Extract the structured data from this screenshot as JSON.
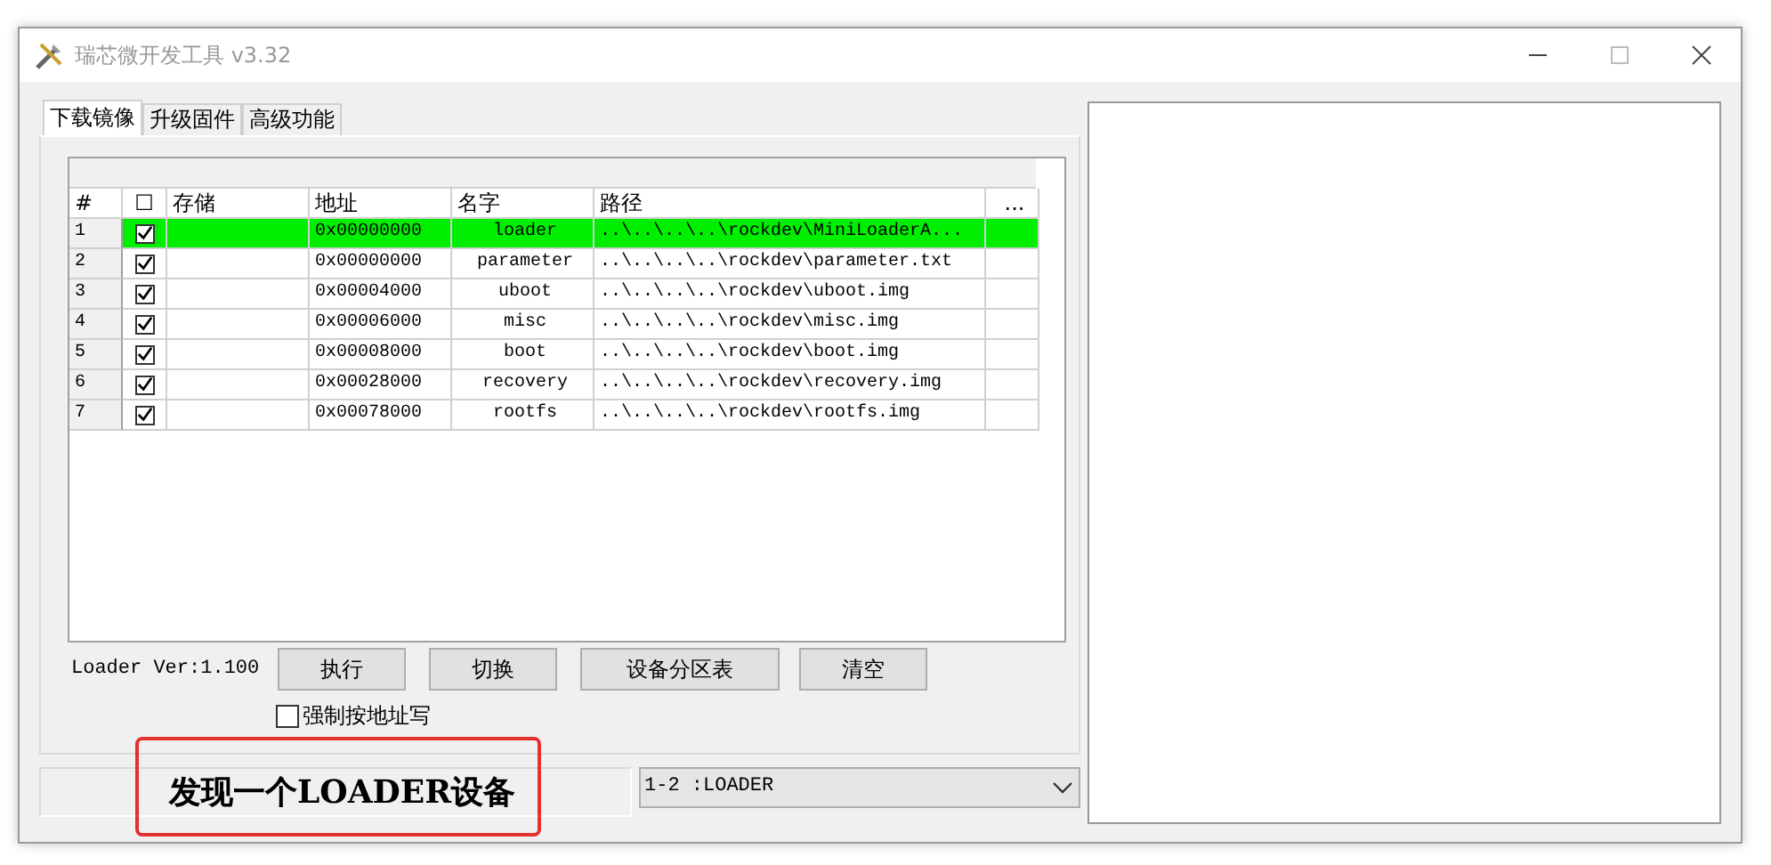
{
  "window": {
    "title": "瑞芯微开发工具 v3.32"
  },
  "tabs": [
    {
      "label": "下载镜像",
      "selected": true
    },
    {
      "label": "升级固件",
      "selected": false
    },
    {
      "label": "高级功能",
      "selected": false
    }
  ],
  "table": {
    "columns": [
      "#",
      "☐",
      "存储",
      "地址",
      "名字",
      "路径",
      "..."
    ],
    "rows": [
      {
        "index": "1",
        "checked": true,
        "address": "0x00000000",
        "name": "loader",
        "path": "..\\..\\..\\..\\rockdev\\MiniLoaderA...",
        "selected": true
      },
      {
        "index": "2",
        "checked": true,
        "address": "0x00000000",
        "name": "parameter",
        "path": "..\\..\\..\\..\\rockdev\\parameter.txt",
        "selected": false
      },
      {
        "index": "3",
        "checked": true,
        "address": "0x00004000",
        "name": "uboot",
        "path": "..\\..\\..\\..\\rockdev\\uboot.img",
        "selected": false
      },
      {
        "index": "4",
        "checked": true,
        "address": "0x00006000",
        "name": "misc",
        "path": "..\\..\\..\\..\\rockdev\\misc.img",
        "selected": false
      },
      {
        "index": "5",
        "checked": true,
        "address": "0x00008000",
        "name": "boot",
        "path": "..\\..\\..\\..\\rockdev\\boot.img",
        "selected": false
      },
      {
        "index": "6",
        "checked": true,
        "address": "0x00028000",
        "name": "recovery",
        "path": "..\\..\\..\\..\\rockdev\\recovery.img",
        "selected": false
      },
      {
        "index": "7",
        "checked": true,
        "address": "0x00078000",
        "name": "rootfs",
        "path": "..\\..\\..\\..\\rockdev\\rootfs.img",
        "selected": false
      }
    ]
  },
  "loader_version": "Loader Ver:1.100",
  "buttons": [
    "执行",
    "切换",
    "设备分区表",
    "清空"
  ],
  "force_address_write": {
    "label": "强制按地址写",
    "checked": false
  },
  "status_message": "发现一个LOADER设备",
  "device_select": {
    "value": "1-2 :LOADER"
  }
}
